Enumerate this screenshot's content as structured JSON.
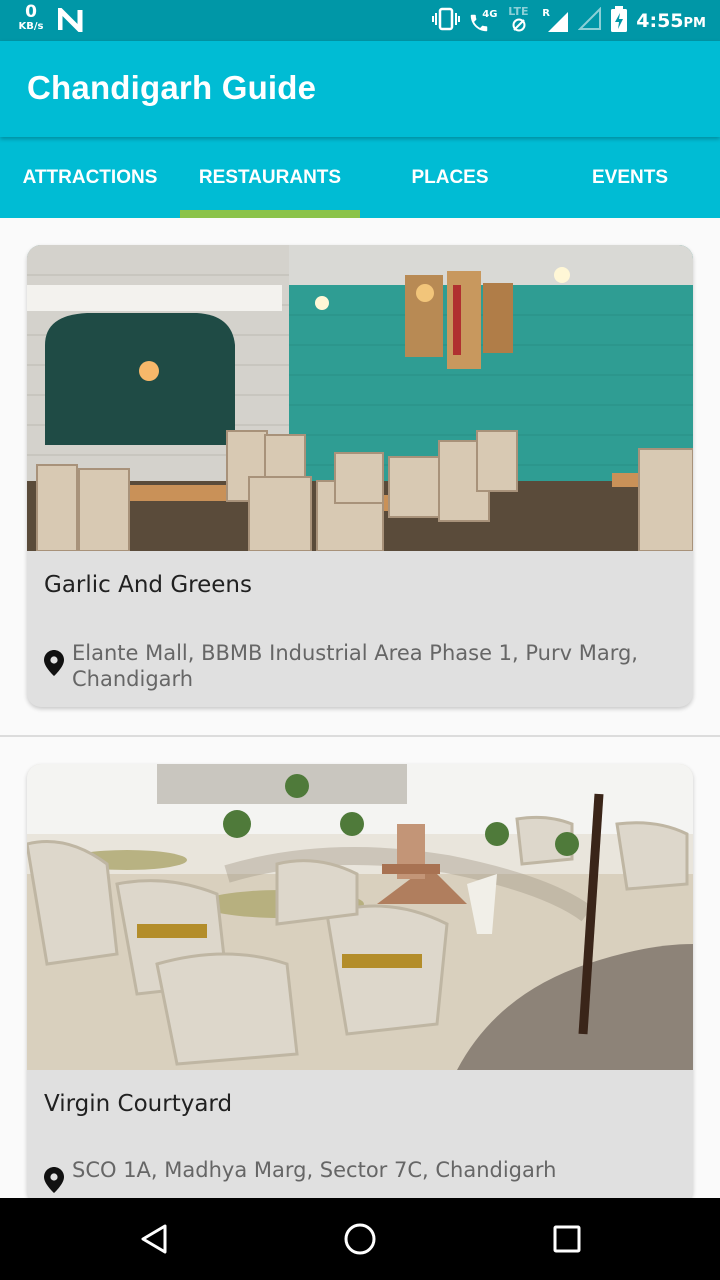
{
  "status_bar": {
    "speed_value": "0",
    "speed_unit": "KB/s",
    "network_label": "4G",
    "lte_label": "LTE",
    "roaming_label": "R",
    "time": "4:55",
    "ampm": "PM",
    "icons": [
      "n-logo-icon",
      "vibrate-icon",
      "call-4g-icon",
      "data-saver-icon",
      "signal-icon",
      "signal-empty-icon",
      "battery-charging-icon"
    ]
  },
  "app_bar": {
    "title": "Chandigarh Guide",
    "color": "#00bcd4"
  },
  "tabs": [
    {
      "label": "ATTRACTIONS",
      "active": false
    },
    {
      "label": "RESTAURANTS",
      "active": true
    },
    {
      "label": "PLACES",
      "active": false
    },
    {
      "label": "EVENTS",
      "active": false
    }
  ],
  "tab_indicator_color": "#8bc34a",
  "restaurants": [
    {
      "name": "Garlic And Greens",
      "address": "Elante Mall, BBMB Industrial Area Phase 1, Purv Marg, Chandigarh",
      "image": "teal brick-wall restaurant interior with wooden tables and chairs"
    },
    {
      "name": "Virgin Courtyard",
      "address": "SCO 1A, Madhya Marg, Sector 7C, Chandigarh",
      "image": "outdoor courtyard with wicker chairs and a fountain"
    }
  ],
  "nav_bar": {
    "buttons": [
      "back-icon",
      "home-icon",
      "recents-icon"
    ]
  }
}
